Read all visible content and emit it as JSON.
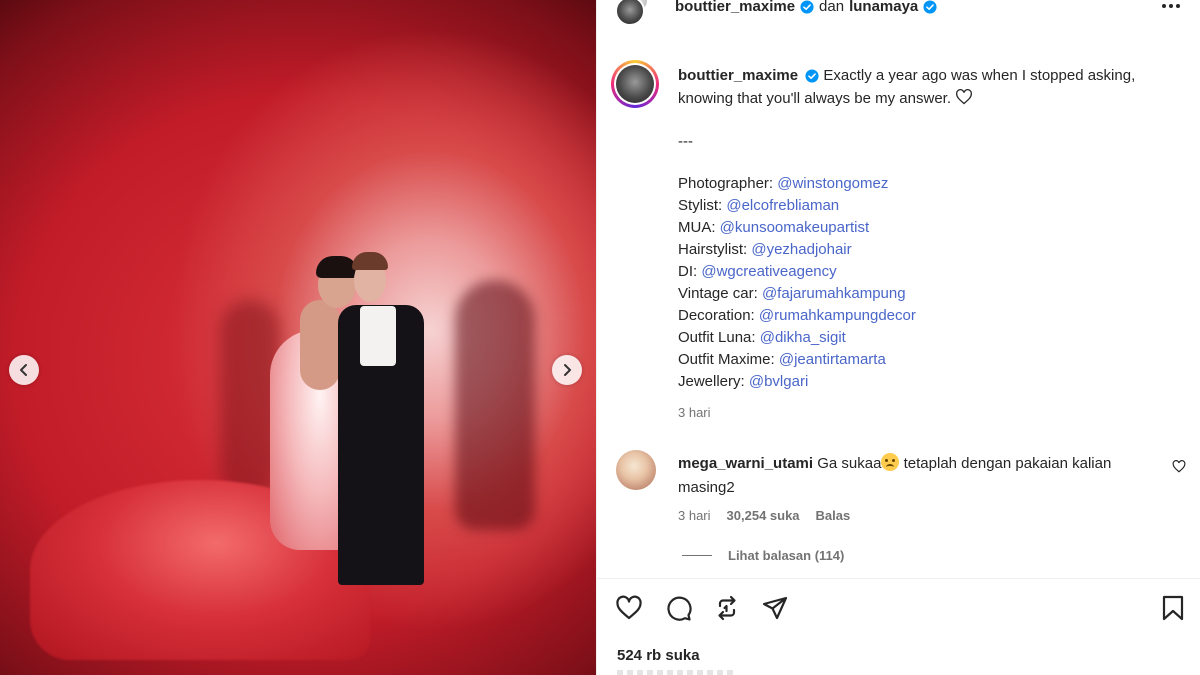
{
  "post": {
    "header": {
      "user_primary": "bouttier_maxime",
      "conjunction": "dan",
      "user_secondary": "lunamaya",
      "more_icon": "more-horizontal-icon"
    },
    "caption": {
      "username": "bouttier_maxime",
      "text": "Exactly a year ago was when I stopped asking, knowing that you'll always be my answer.",
      "separator": "---",
      "credits": [
        {
          "label": "Photographer:",
          "handle": "@winstongomez"
        },
        {
          "label": "Stylist:",
          "handle": "@elcofrebliaman"
        },
        {
          "label": "MUA:",
          "handle": "@kunsoomakeupartist"
        },
        {
          "label": "Hairstylist:",
          "handle": "@yezhadjohair"
        },
        {
          "label": "DI:",
          "handle": "@wgcreativeagency"
        },
        {
          "label": "Vintage car:",
          "handle": "@fajarumahkampung"
        },
        {
          "label": "Decoration:",
          "handle": "@rumahkampungdecor"
        },
        {
          "label": "Outfit Luna:",
          "handle": "@dikha_sigit"
        },
        {
          "label": "Outfit Maxime:",
          "handle": "@jeantirtamarta"
        },
        {
          "label": "Jewellery:",
          "handle": "@bvlgari"
        }
      ],
      "time": "3 hari"
    },
    "comment": {
      "username": "mega_warni_utami",
      "text_before": "Ga sukaa",
      "text_after": " tetaplah dengan pakaian kalian masing2",
      "time": "3 hari",
      "likes": "30,254 suka",
      "reply": "Balas",
      "view_replies": "Lihat balasan (114)"
    },
    "likes": "524 rb suka"
  },
  "colors": {
    "mention": "#4a66c9",
    "verified": "#0095f6",
    "muted": "#737373"
  }
}
